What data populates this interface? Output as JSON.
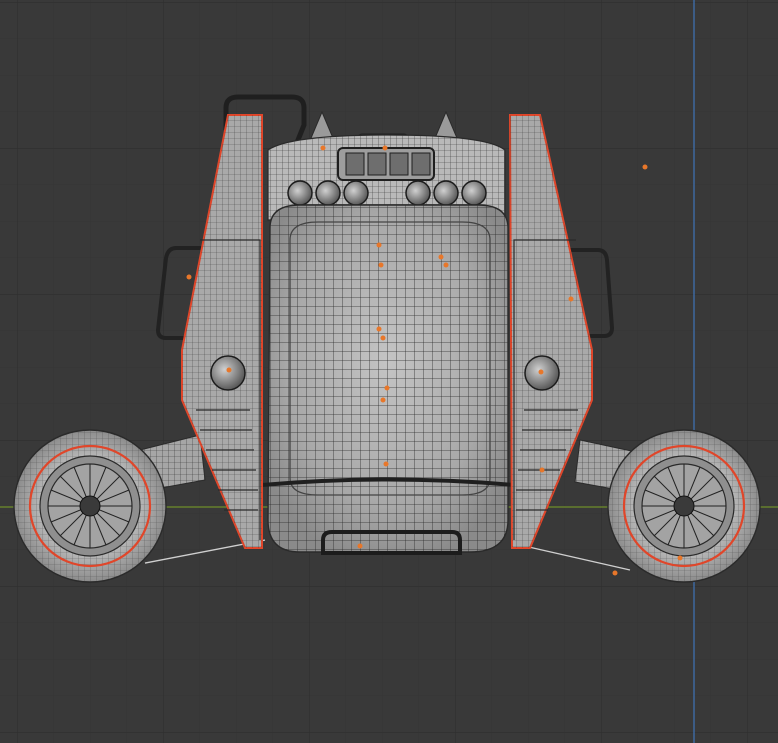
{
  "viewport": {
    "view": "front-orthographic",
    "shading": "wireframe",
    "background_color": "#393939",
    "grid_minor_color": "#353535",
    "grid_major_color": "#2d2d2d",
    "x_axis_color": "#7a9a2a",
    "z_axis_color": "#4a78b8"
  },
  "model": {
    "kind": "jetpack",
    "wire_color": "#c9c9c9",
    "mesh_fill": "#8c8c8c",
    "selection_outline_color": "#e0462a",
    "empty_color": "#e8772a",
    "parts": {
      "backpack_body": "backpack-body",
      "lamps_count": 6,
      "wings": [
        "left-wing",
        "right-wing"
      ],
      "thrusters": [
        "left-thruster",
        "right-thruster"
      ]
    }
  }
}
